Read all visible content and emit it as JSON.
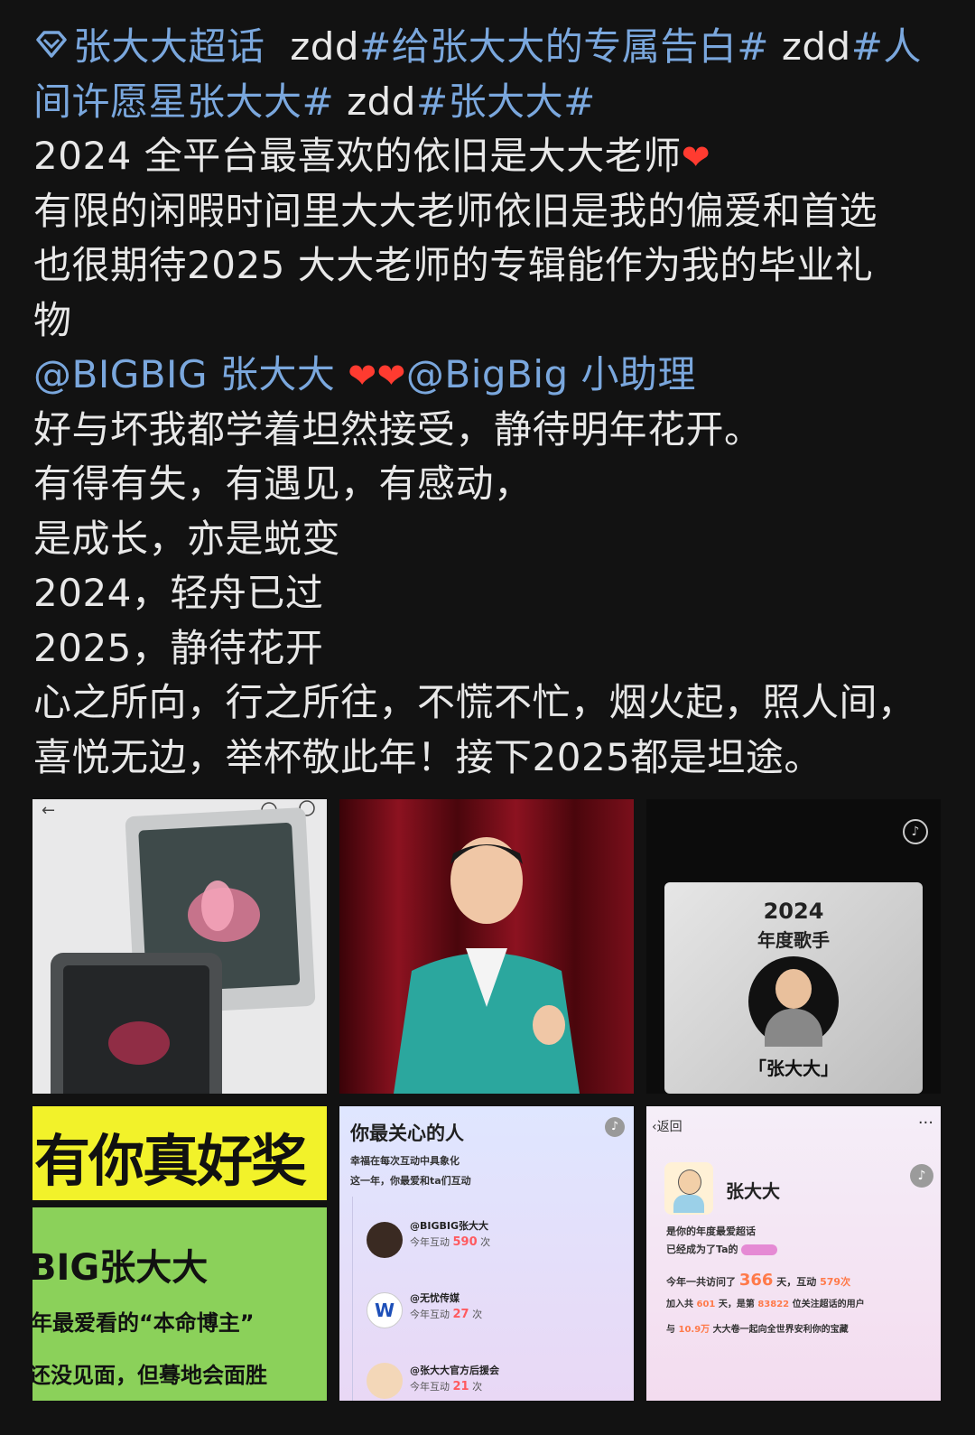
{
  "post": {
    "topic_super": "张大大超话",
    "prefix1": "zdd",
    "tag1": "#给张大大的专属告白#",
    "prefix2": "zdd",
    "tag2a": "#人",
    "tag2b": "间许愿星张大大#",
    "prefix3": "zdd",
    "tag3": "#张大大#",
    "line3": "2024 全平台最喜欢的依旧是大大老师",
    "line4": "有限的闲暇时间里大大老师依旧是我的偏爱和首选",
    "line5": "也很期待2025 大大老师的专辑能作为我的毕业礼",
    "line6": "物",
    "mention1": "@BIGBIG 张大大",
    "mention2": "@BigBig 小助理",
    "line8": "好与坏我都学着坦然接受，静待明年花开。",
    "line9": "有得有失，有遇见，有感动，",
    "line10": "是成长，亦是蜕变",
    "line11": "2024，轻舟已过",
    "line12": "2025，静待花开",
    "line13": "心之所向，行之所往，不慌不忙，烟火起，照人间，",
    "line14": "喜悦无边，举杯敬此年！接下2025都是坦途。"
  },
  "images": {
    "img3": {
      "year": "2024",
      "title": "年度歌手",
      "name": "「张大大」"
    },
    "img4": {
      "award": "有你真好奖",
      "name": "BIG张大大",
      "line2": "年最爱看的“本命博主”",
      "line3": "还没见面，但蓦地会面胜"
    },
    "img5": {
      "title": "你最关心的人",
      "subtitle": "幸福在每次互动中具象化",
      "subtitle2": "这一年，你最爱和ta们互动",
      "entries": [
        {
          "name": "@BIGBIG张大大",
          "count_label": "今年互动",
          "count": "590",
          "unit": "次"
        },
        {
          "name": "@无忧传媒",
          "count_label": "今年互动",
          "count": "27",
          "unit": "次"
        },
        {
          "name": "@张大大官方后援会",
          "count_label": "今年互动",
          "count": "21",
          "unit": "次"
        }
      ]
    },
    "img6": {
      "back": "返回",
      "name": "张大大",
      "line1": "是你的年度最爱超话",
      "line2": "已经成为了Ta的",
      "visit_prefix": "今年一共访问了",
      "visit_days": "366",
      "visit_mid": "天，互动",
      "visit_count": "579次",
      "join_prefix": "加入共",
      "join_days": "601",
      "join_mid": "天，是第",
      "join_rank": "83822",
      "join_suffix": "位关注超话的用户",
      "with_prefix": "与",
      "with_count": "10.9万",
      "with_suffix": "大大卷一起向全世界安利你的宝藏"
    }
  },
  "colors": {
    "link": "#7aa7dd",
    "text": "#e8e8e8",
    "background": "#121212",
    "heart": "#ff3b30"
  }
}
